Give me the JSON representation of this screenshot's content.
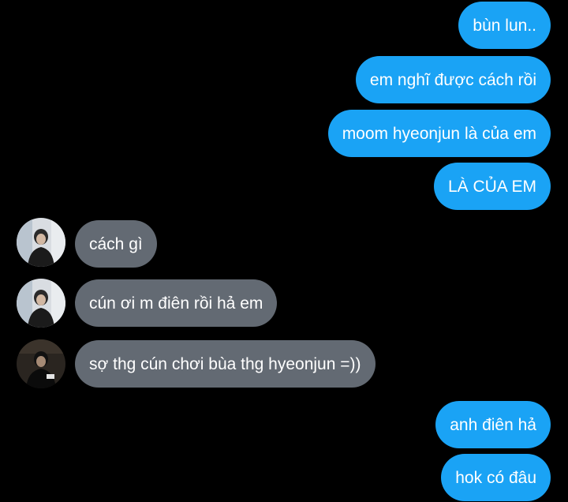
{
  "chat": {
    "messages": [
      {
        "side": "sent",
        "text": "bùn lun.."
      },
      {
        "side": "sent",
        "text": "em nghĩ được cách rồi"
      },
      {
        "side": "sent",
        "text": "moom hyeonjun là của em"
      },
      {
        "side": "sent",
        "text": "LÀ CỦA EM"
      },
      {
        "side": "received",
        "text": "cách gì",
        "avatar": "contact-photo"
      },
      {
        "side": "received",
        "text": "cún ơi m điên rồi hả em",
        "avatar": "contact-photo"
      },
      {
        "side": "received",
        "text": "sợ thg cún chơi bùa thg hyeonjun =))",
        "avatar": "contact-photo-dark"
      },
      {
        "side": "sent",
        "text": "anh điên hả"
      },
      {
        "side": "sent",
        "text": "hok có đâu"
      }
    ]
  },
  "colors": {
    "background": "#000000",
    "sent_bubble": "#1aa3f5",
    "received_bubble": "#636a73",
    "text": "#ffffff"
  }
}
